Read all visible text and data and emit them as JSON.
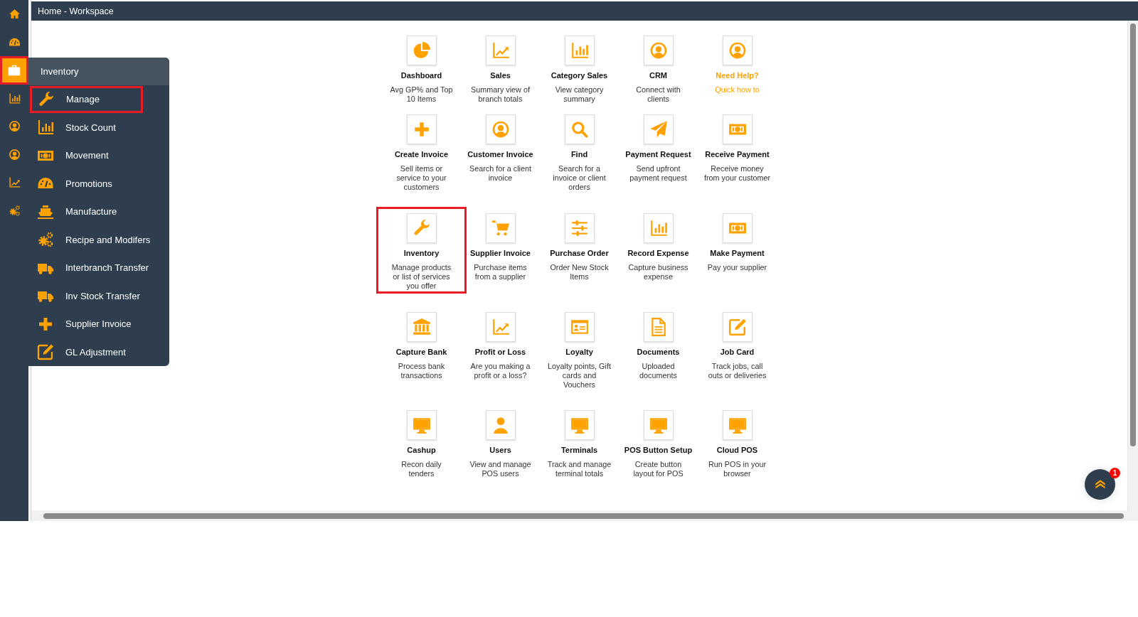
{
  "header": {
    "breadcrumb": "Home - Workspace"
  },
  "sidebar": {
    "items": [
      {
        "selected": false,
        "highlighted": false
      },
      {
        "selected": false,
        "highlighted": false
      },
      {
        "selected": true,
        "highlighted": true
      },
      {
        "selected": false,
        "highlighted": false
      },
      {
        "selected": false,
        "highlighted": false
      },
      {
        "selected": false,
        "highlighted": false
      },
      {
        "selected": false,
        "highlighted": false
      },
      {
        "selected": false,
        "highlighted": false
      }
    ]
  },
  "menu": {
    "title": "Inventory",
    "items": [
      {
        "label": "Manage",
        "highlighted": true
      },
      {
        "label": "Stock Count",
        "highlighted": false
      },
      {
        "label": "Movement",
        "highlighted": false
      },
      {
        "label": "Promotions",
        "highlighted": false
      },
      {
        "label": "Manufacture",
        "highlighted": false
      },
      {
        "label": "Recipe and Modifers",
        "highlighted": false
      },
      {
        "label": "Interbranch Transfer",
        "highlighted": false
      },
      {
        "label": "Inv Stock Transfer",
        "highlighted": false
      },
      {
        "label": "Supplier Invoice",
        "highlighted": false
      },
      {
        "label": "GL Adjustment",
        "highlighted": false
      }
    ]
  },
  "tiles": [
    {
      "kind": "app",
      "title": "Dashboard",
      "description": "Avg GP% and Top 10 Items",
      "highlighted": false
    },
    {
      "kind": "app",
      "title": "Sales",
      "description": "Summary view of branch totals",
      "highlighted": false
    },
    {
      "kind": "app",
      "title": "Category Sales",
      "description": "View category summary",
      "highlighted": false
    },
    {
      "kind": "app",
      "title": "CRM",
      "description": "Connect with clients",
      "highlighted": false
    },
    {
      "kind": "help",
      "title": "Need Help?",
      "description": "Quick how to",
      "highlighted": false
    },
    {
      "kind": "app",
      "title": "Create Invoice",
      "description": "Sell items or service to your customers",
      "highlighted": false
    },
    {
      "kind": "app",
      "title": "Customer Invoice",
      "description": "Search for a client invoice",
      "highlighted": false
    },
    {
      "kind": "app",
      "title": "Find",
      "description": "Search for a invoice or client orders",
      "highlighted": false
    },
    {
      "kind": "app",
      "title": "Payment Request",
      "description": "Send upfront payment request",
      "highlighted": false
    },
    {
      "kind": "app",
      "title": "Receive Payment",
      "description": "Receive money from your customer",
      "highlighted": false
    },
    {
      "kind": "app",
      "title": "Inventory",
      "description": "Manage products or list of services you offer",
      "highlighted": true
    },
    {
      "kind": "app",
      "title": "Supplier Invoice",
      "description": "Purchase items from a supplier",
      "highlighted": false
    },
    {
      "kind": "app",
      "title": "Purchase Order",
      "description": "Order New Stock Items",
      "highlighted": false
    },
    {
      "kind": "app",
      "title": "Record Expense",
      "description": "Capture business expense",
      "highlighted": false
    },
    {
      "kind": "app",
      "title": "Make Payment",
      "description": "Pay your supplier",
      "highlighted": false
    },
    {
      "kind": "app",
      "title": "Capture Bank",
      "description": "Process bank transactions",
      "highlighted": false
    },
    {
      "kind": "app",
      "title": "Profit or Loss",
      "description": "Are you making a profit or a loss?",
      "highlighted": false
    },
    {
      "kind": "app",
      "title": "Loyalty",
      "description": "Loyalty points, Gift cards and Vouchers",
      "highlighted": false
    },
    {
      "kind": "app",
      "title": "Documents",
      "description": "Uploaded documents",
      "highlighted": false
    },
    {
      "kind": "app",
      "title": "Job Card",
      "description": "Track jobs, call outs or deliveries",
      "highlighted": false
    },
    {
      "kind": "app",
      "title": "Cashup",
      "description": "Recon daily tenders",
      "highlighted": false
    },
    {
      "kind": "app",
      "title": "Users",
      "description": "View and manage POS users",
      "highlighted": false
    },
    {
      "kind": "app",
      "title": "Terminals",
      "description": "Track and manage terminal totals",
      "highlighted": false
    },
    {
      "kind": "app",
      "title": "POS Button Setup",
      "description": "Create button layout for POS",
      "highlighted": false
    },
    {
      "kind": "app",
      "title": "Cloud POS",
      "description": "Run POS in your browser",
      "highlighted": false
    }
  ],
  "chat": {
    "badge": "1"
  }
}
